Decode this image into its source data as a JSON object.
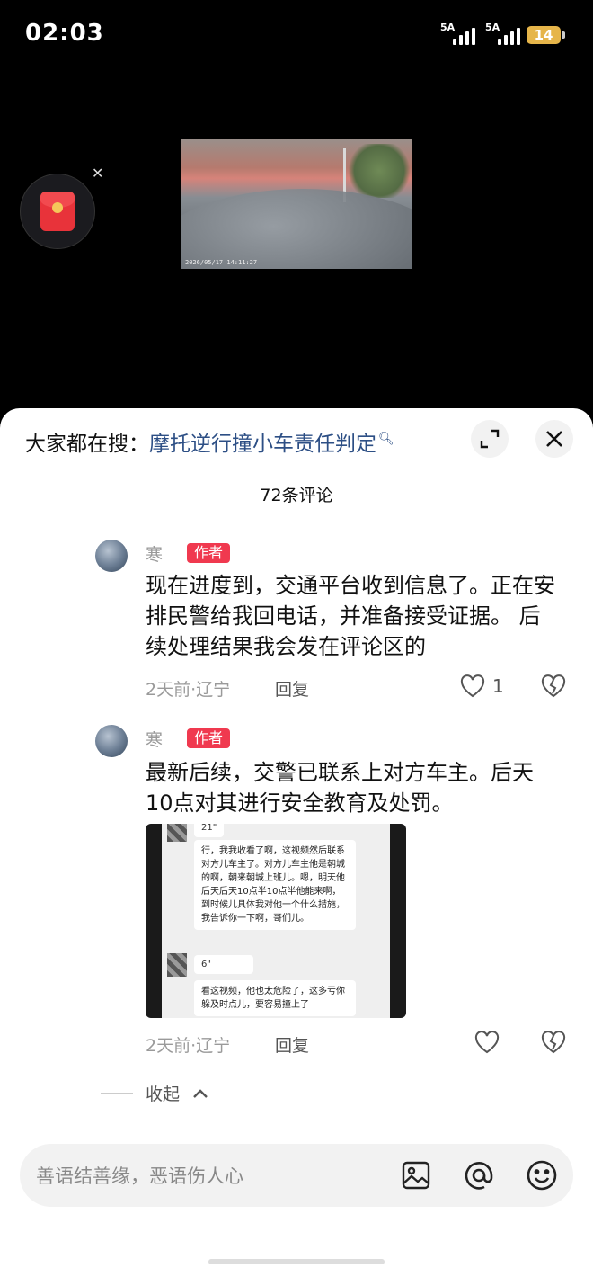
{
  "status": {
    "time": "02:03",
    "signal1": "5A",
    "signal2": "5A",
    "battery": "14"
  },
  "video": {
    "timestamp": "2026/05/17 14:11:27"
  },
  "search": {
    "prefix": "大家都在搜：",
    "keyword": "摩托逆行撞小车责任判定"
  },
  "comments_count": "72条评论",
  "comments": [
    {
      "user": "寒",
      "badge": "作者",
      "text": "现在进度到，交通平台收到信息了。正在安排民警给我回电话，并准备接受证据。 后续处理结果我会发在评论区的",
      "meta": "2天前·辽宁",
      "reply": "回复",
      "likes": "1"
    },
    {
      "user": "寒",
      "badge": "作者",
      "text": "最新后续，交警已联系上对方车主。后天10点对其进行安全教育及处罚。",
      "meta": "2天前·辽宁",
      "reply": "回复",
      "likes": "",
      "image": {
        "voice1": "21\"",
        "msg1": "行，我我收看了啊，这视频然后联系对方儿车主了。对方儿车主他是朝城的啊，朝来朝城上班儿。嗯，明天他后天后天10点半10点半他能来啊，到时候儿具体我对他一个什么措施，我告诉你一下啊，哥们儿。",
        "voice2": "6\"",
        "msg2": "看这视频，他也太危险了，这多亏你躲及时点儿，要容易撞上了"
      }
    }
  ],
  "collapse_label": "收起",
  "input": {
    "placeholder": "善语结善缘，恶语伤人心"
  },
  "icons": [
    "expand-icon",
    "close-icon",
    "heart-icon",
    "broken-heart-icon",
    "image-icon",
    "at-icon",
    "emoji-icon",
    "chevron-up-icon"
  ]
}
